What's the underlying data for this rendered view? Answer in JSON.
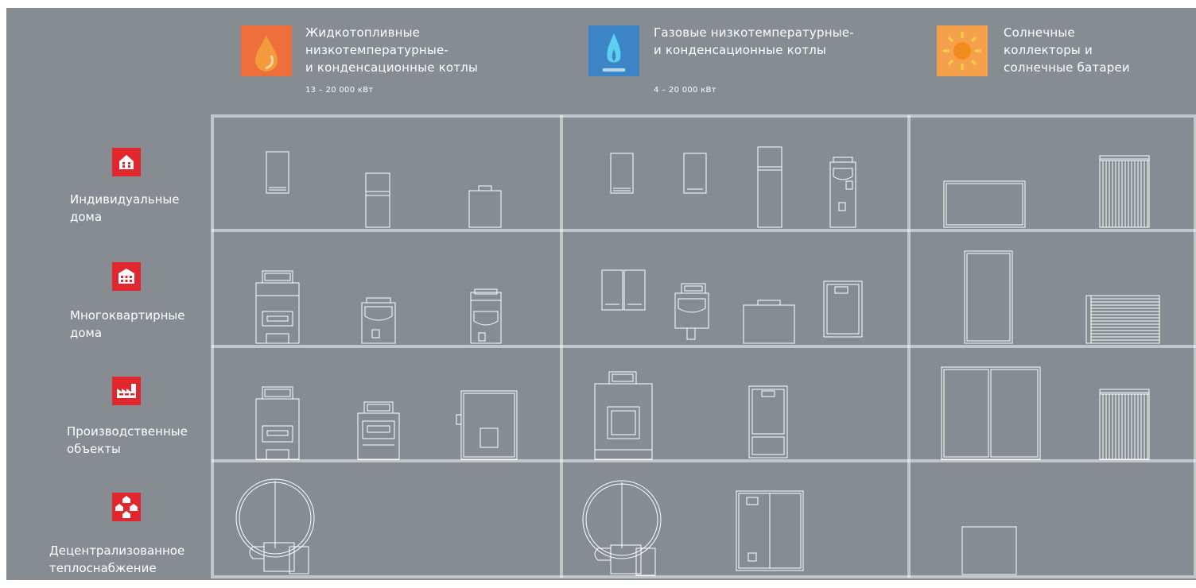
{
  "categories": [
    {
      "title_lines": [
        "Жидкотопливные",
        "низкотемпературные-",
        "и конденсационные котлы"
      ],
      "range": "13 – 20 000 кВт",
      "icon": "oil-drop-icon",
      "color": "#ee6f3c"
    },
    {
      "title_lines": [
        "Газовые низкотемпературные-",
        "и конденсационные котлы"
      ],
      "range": "4 – 20 000 кВт",
      "icon": "gas-flame-icon",
      "color": "#3c86c8"
    },
    {
      "title_lines": [
        "Солнечные",
        "коллекторы и",
        "солнечные батареи"
      ],
      "range": "",
      "icon": "sun-icon",
      "color": "#f5a04a"
    }
  ],
  "rows": [
    {
      "label_lines": [
        "Индивидуальные",
        "дома"
      ],
      "icon": "house-icon"
    },
    {
      "label_lines": [
        "Многоквартирные",
        "дома"
      ],
      "icon": "apartment-building-icon"
    },
    {
      "label_lines": [
        "Производственные",
        "объекты"
      ],
      "icon": "factory-icon"
    },
    {
      "label_lines": [
        "Децентрализованное",
        "теплоснабжение"
      ],
      "icon": "district-heating-icon"
    }
  ],
  "colors": {
    "panel": "#878c92",
    "lines": "#ffffff",
    "row_icon_bg": "#e2262d"
  }
}
